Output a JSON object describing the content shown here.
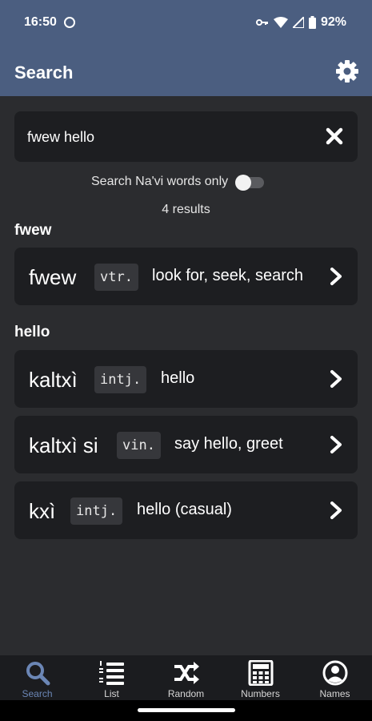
{
  "status": {
    "time": "16:50",
    "battery": "92%"
  },
  "appbar": {
    "title": "Search"
  },
  "search": {
    "value": "fwew hello"
  },
  "toggle": {
    "label": "Search Na'vi words only",
    "on": false
  },
  "results_count": "4 results",
  "sections": [
    {
      "heading": "fwew",
      "entries": [
        {
          "word": "fwew",
          "pos": "vtr.",
          "definition": "look for, seek, search"
        }
      ]
    },
    {
      "heading": "hello",
      "entries": [
        {
          "word": "kaltxì",
          "pos": "intj.",
          "definition": "hello"
        },
        {
          "word": "kaltxì si",
          "pos": "vin.",
          "definition": "say hello, greet"
        },
        {
          "word": "kxì",
          "pos": "intj.",
          "definition": "hello (casual)"
        }
      ]
    }
  ],
  "nav": [
    {
      "label": "Search",
      "icon": "search-icon",
      "active": true
    },
    {
      "label": "List",
      "icon": "numbered-list-icon",
      "active": false
    },
    {
      "label": "Random",
      "icon": "shuffle-icon",
      "active": false
    },
    {
      "label": "Numbers",
      "icon": "calculator-icon",
      "active": false
    },
    {
      "label": "Names",
      "icon": "account-circle-icon",
      "active": false
    }
  ],
  "colors": {
    "appbar": "#4b5e80",
    "background": "#2b2c2f",
    "card": "#1d1e21",
    "active_nav": "#6b86b5"
  }
}
